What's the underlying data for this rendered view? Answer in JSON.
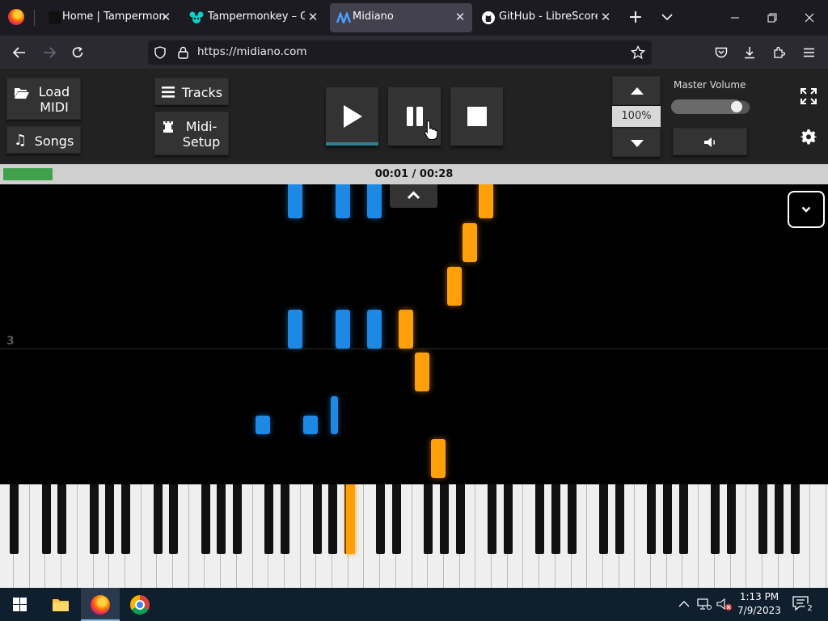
{
  "browser": {
    "tabs": [
      {
        "label": "Home | Tampermonkey",
        "icon": "tampermonkey-dark-icon",
        "active": false
      },
      {
        "label": "Tampermonkey – Get th",
        "icon": "tampermonkey-teal-icon",
        "active": false
      },
      {
        "label": "Midiano",
        "icon": "midiano-icon",
        "active": true
      },
      {
        "label": "GitHub - LibreScore/dl",
        "icon": "github-icon",
        "active": false
      }
    ],
    "url": "https://midiano.com"
  },
  "toolbar": {
    "load_midi": "Load MIDI",
    "songs": "Songs",
    "tracks": "Tracks",
    "midi_setup": "Midi-Setup",
    "speed": "100%",
    "master_volume_label": "Master Volume",
    "volume_fraction": 0.9
  },
  "playback": {
    "time": "00:01 / 00:28",
    "progress_fraction": 0.06
  },
  "roll": {
    "measure_number": "3"
  },
  "taskbar": {
    "time": "1:13 PM",
    "date": "7/9/2023",
    "notifications": "2"
  },
  "colors": {
    "left_hand": "#1e88e5",
    "right_hand": "#ff9f0a",
    "progress": "#3fa14a",
    "tab_bar": "#1c1b22",
    "nav_bar": "#2b2a33"
  }
}
